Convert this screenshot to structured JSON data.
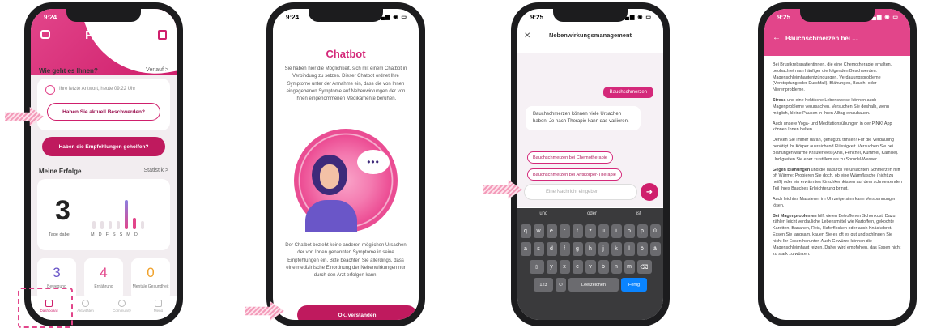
{
  "phone1": {
    "time": "9:24",
    "title": "PINK!",
    "question_heading": "Wie geht es Ihnen?",
    "history_link": "Verlauf >",
    "last_answer": "Ihre letzte Antwort, heute 09:22 Uhr",
    "btn_complaints": "Haben Sie aktuell Beschwerden?",
    "btn_recommendations": "Haben die Empfehlungen geholfen?",
    "achievements_heading": "Meine Erfolge",
    "stats_link": "Statistik >",
    "days_count": "3",
    "days_label": "Tage dabei",
    "weekdays": [
      "M",
      "D",
      "F",
      "S",
      "S",
      "M",
      "D"
    ],
    "stats": [
      {
        "value": "3",
        "label": "Bewegung",
        "color": "#6a56c8"
      },
      {
        "value": "4",
        "label": "Ernährung",
        "color": "#e2458a"
      },
      {
        "value": "0",
        "label": "Mentale Gesundheit",
        "color": "#f0a12a"
      }
    ],
    "tabs": [
      "Dashboard",
      "Aktivitäten",
      "Community",
      "Menü"
    ]
  },
  "phone2": {
    "time": "9:24",
    "title": "Chatbot",
    "intro": "Sie haben hier die Möglichkeit, sich mit einem Chatbot in Verbindung zu setzen. Dieser Chatbot ordnet Ihre Symptome unter der Annahme ein, dass die von Ihnen eingegebenen Symptome auf Nebenwirkungen der von Ihnen eingenommenen Medikamente beruhen.",
    "disclaimer": "Der Chatbot bezieht keine anderen möglichen Ursachen der von Ihnen genannten Symptome in seine Empfehlungen ein. Bitte beachten Sie allerdings, dass eine medizinische Einordnung der Nebenwirkungen nur durch den Arzt erfolgen kann.",
    "button": "Ok, verstanden"
  },
  "phone3": {
    "time": "9:25",
    "title": "Nebenwirkungsmanagement",
    "user_message": "Bauchschmerzen",
    "bot_message": "Bauchschmerzen können viele Ursachen haben. Je nach Therapie kann das variieren.",
    "chips": [
      "Bauchschmerzen bei Chemotherapie",
      "Bauchschmerzen bei Antikörper-Therapie"
    ],
    "input_placeholder": "Eine Nachricht eingeben",
    "suggestions": [
      "und",
      "oder",
      "ist"
    ],
    "keys_row1": [
      "q",
      "w",
      "e",
      "r",
      "t",
      "z",
      "u",
      "i",
      "o",
      "p",
      "ü"
    ],
    "keys_row2": [
      "a",
      "s",
      "d",
      "f",
      "g",
      "h",
      "j",
      "k",
      "l",
      "ö",
      "ä"
    ],
    "keys_row3": [
      "⇧",
      "y",
      "x",
      "c",
      "v",
      "b",
      "n",
      "m",
      "⌫"
    ],
    "key_numbers": "123",
    "key_space": "Leerzeichen",
    "key_done": "Fertig"
  },
  "phone4": {
    "time": "9:25",
    "title": "Bauchschmerzen bei ...",
    "paragraphs": [
      {
        "bold": "",
        "text": "Bei Brustkrebspatientinnen, die eine Chemotherapie erhalten, beobachtet man häufiger die folgenden Beschwerden: Magenschleimhautentzündungen, Verdauungsprobleme (Verstopfung oder Durchfall), Blähungen, Bauch- oder Nierenprobleme."
      },
      {
        "bold": "Stress",
        "text": " und eine hektische Lebensweise können auch Magenprobleme verursachen. Versuchen Sie deshalb, wenn möglich, kleine Pausen in Ihren Alltag einzubauen."
      },
      {
        "bold": "",
        "text": "Auch unsere Yoga- und Meditationsübungen in der PINK! App können Ihnen helfen."
      },
      {
        "bold": "",
        "text": "Denken Sie immer daran, genug zu trinken! Für die Verdauung benötigt Ihr Körper ausreichend Flüssigkeit. Versuchen Sie bei Blähungen warme Kräutertees (Anis, Fenchel, Kümmel, Kamille). Und greifen Sie eher zu stillem als zu Sprudel-Wasser."
      },
      {
        "bold": "Gegen Blähungen",
        "text": " und die dadurch verursachten Schmerzen hilft oft Wärme: Probieren Sie doch, ob eine Wärmflasche (nicht zu heiß) oder ein erwärmtes Kirschkernkissen auf dem schmerzenden Teil Ihres Bauches Erleichterung bringt."
      },
      {
        "bold": "",
        "text": "Auch leichtes Massieren im Uhrzeigersinn kann Verspannungen lösen."
      },
      {
        "bold": "Bei Magenproblemen",
        "text": " hilft vielen Betroffenen Schonkost. Dazu zählen leicht verdauliche Lebensmittel wie Kartoffeln, gekochte Karotten, Bananen, Reis, Haferflocken oder auch Knäckebrot. Essen Sie langsam, kauen Sie es oft es gut und schlingen Sie nicht Ihr Essen herunter. Auch Gewürze können die Magenschleimhaut reizen. Daher wird empfohlen, das Essen nicht zu stark zu würzen."
      }
    ]
  },
  "colors": {
    "brand_pink": "#cf1f6c",
    "accent_pink": "#e2458a",
    "purple": "#6a56c8"
  }
}
